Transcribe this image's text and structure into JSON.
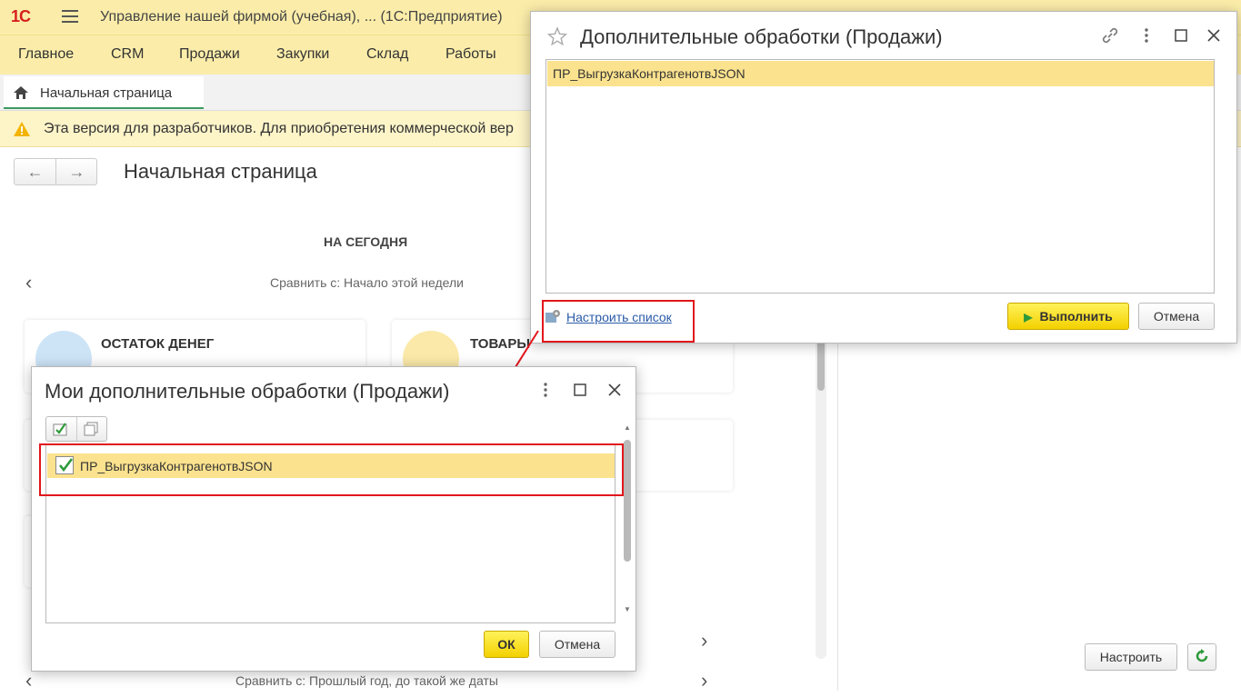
{
  "app": {
    "logo": "1С",
    "title": "Управление нашей фирмой (учебная), ...  (1С:Предприятие)"
  },
  "menu": [
    "Главное",
    "CRM",
    "Продажи",
    "Закупки",
    "Склад",
    "Работы"
  ],
  "tabs": {
    "home_label": "Начальная страница"
  },
  "banner": {
    "text": "Эта версия для разработчиков. Для приобретения коммерческой вер"
  },
  "page": {
    "title": "Начальная страница",
    "today_label": "НА СЕГОДНЯ",
    "compare_week": "Сравнить с: Начало этой недели",
    "compare_year": "Сравнить с: Прошлый год, до такой же даты",
    "cards": {
      "money": "ОСТАТОК ДЕНЕГ",
      "goods": "ТОВАРЫ"
    },
    "setup_button": "Настроить"
  },
  "dialog_processing": {
    "title": "Дополнительные обработки (Продажи)",
    "items": [
      "ПР_ВыгрузкаКонтрагенотвJSON"
    ],
    "configure_link": "Настроить список",
    "run_button": "Выполнить",
    "cancel_button": "Отмена"
  },
  "dialog_my": {
    "title": "Мои дополнительные обработки (Продажи)",
    "items": [
      {
        "label": "ПР_ВыгрузкаКонтрагенотвJSON",
        "checked": true
      }
    ],
    "ok_button": "ОК",
    "cancel_button": "Отмена"
  },
  "colors": {
    "brand_bar": "#fbeda9",
    "selection": "#fbe28e",
    "highlight_red": "#e2161b",
    "primary_button": "#f3d100",
    "link": "#2a5aa8"
  }
}
